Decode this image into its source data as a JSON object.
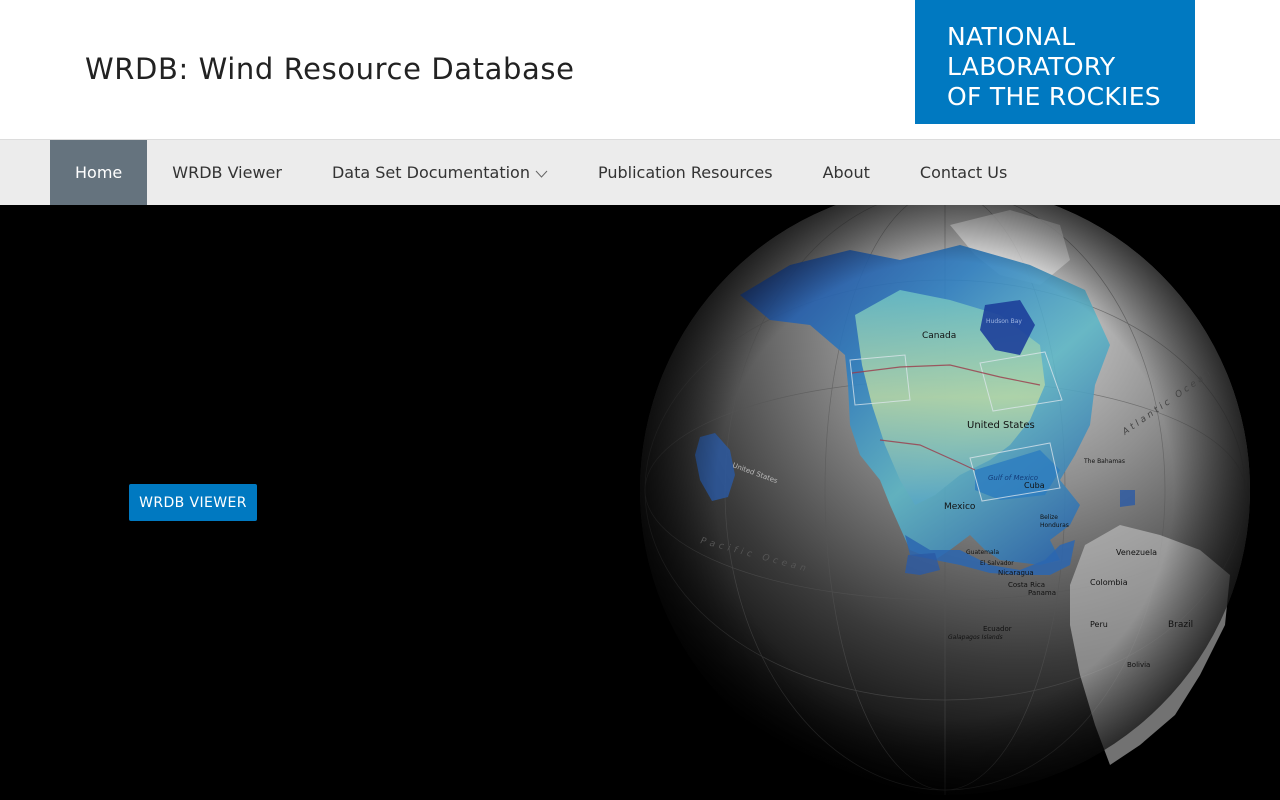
{
  "header": {
    "site_title": "WRDB: Wind Resource Database",
    "logo_lines": [
      "NATIONAL",
      "LABORATORY",
      "OF THE ROCKIES"
    ]
  },
  "nav": {
    "items": [
      {
        "label": "Home",
        "active": true
      },
      {
        "label": "WRDB Viewer"
      },
      {
        "label": "Data Set Documentation",
        "has_dropdown": true
      },
      {
        "label": "Publication Resources"
      },
      {
        "label": "About"
      },
      {
        "label": "Contact Us"
      }
    ]
  },
  "hero": {
    "cta_label": "WRDB VIEWER",
    "map_labels": {
      "canada": "Canada",
      "united_states": "United States",
      "mexico": "Mexico",
      "cuba": "Cuba",
      "gulf": "Gulf of Mexico",
      "venezuela": "Venezuela",
      "colombia": "Colombia",
      "peru": "Peru",
      "brazil": "Brazil",
      "ecuador": "Ecuador",
      "panama": "Panama",
      "costa_rica": "Costa Rica",
      "nicaragua": "Nicaragua",
      "belize": "Belize",
      "el_salvador": "El Salvador",
      "guatemala": "Guatemala",
      "honduras": "Honduras",
      "pacific": "Pacific Ocean",
      "atlantic": "Atlantic Ocean",
      "bahamas": "The Bahamas",
      "hudson": "Hudson Bay",
      "galapagos": "Galapagos Islands",
      "hawaii": "United States",
      "bolivia": "Bolivia"
    }
  },
  "colors": {
    "brand_blue": "#0079c1",
    "nav_active": "#65737e",
    "nav_bg": "#ececec"
  }
}
